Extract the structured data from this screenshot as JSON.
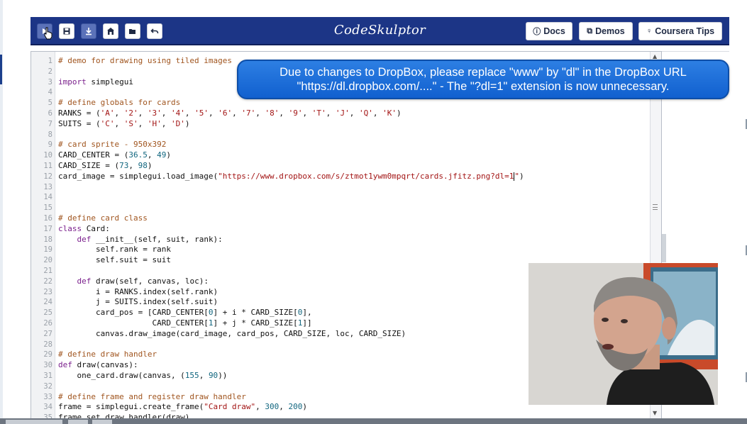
{
  "toolbar": {
    "buttons": [
      {
        "name": "run-button",
        "icon": "play-icon"
      },
      {
        "name": "save-button",
        "icon": "save-icon"
      },
      {
        "name": "download-button",
        "icon": "download-icon"
      },
      {
        "name": "reset-button",
        "icon": "home-icon"
      },
      {
        "name": "open-button",
        "icon": "folder-open-icon"
      },
      {
        "name": "undo-button",
        "icon": "undo-icon"
      }
    ],
    "brand": "CodeSkulptor",
    "docs_label": "Docs",
    "demos_label": "Demos",
    "tips_label": "Coursera Tips"
  },
  "banner": {
    "line1": "Due to changes to DropBox, please replace \"www\" by \"dl\" in the DropBox URL",
    "line2": "\"https://dl.dropbox.com/....\" - The \"?dl=1\" extension is now unnecessary."
  },
  "editor": {
    "line_numbers": [
      "1",
      "2",
      "3",
      "4",
      "5",
      "6",
      "7",
      "8",
      "9",
      "10",
      "11",
      "12",
      "13",
      "14",
      "15",
      "16",
      "17",
      "18",
      "19",
      "20",
      "21",
      "22",
      "23",
      "24",
      "25",
      "26",
      "27",
      "28",
      "29",
      "30",
      "31",
      "32",
      "33",
      "34",
      "35"
    ],
    "lines": [
      "# demo for drawing using tiled images",
      "",
      "import simplegui",
      "",
      "# define globals for cards",
      "RANKS = ('A', '2', '3', '4', '5', '6', '7', '8', '9', 'T', 'J', 'Q', 'K')",
      "SUITS = ('C', 'S', 'H', 'D')",
      "",
      "# card sprite - 950x392",
      "CARD_CENTER = (36.5, 49)",
      "CARD_SIZE = (73, 98)",
      "card_image = simplegui.load_image(\"https://www.dropbox.com/s/ztmot1ywm0mpqrt/cards.jfitz.png?dl=1\")",
      "",
      "",
      "",
      "# define card class",
      "class Card:",
      "    def __init__(self, suit, rank):",
      "        self.rank = rank",
      "        self.suit = suit",
      "",
      "    def draw(self, canvas, loc):",
      "        i = RANKS.index(self.rank)",
      "        j = SUITS.index(self.suit)",
      "        card_pos = [CARD_CENTER[0] + i * CARD_SIZE[0],",
      "                    CARD_CENTER[1] + j * CARD_SIZE[1]]",
      "        canvas.draw_image(card_image, card_pos, CARD_SIZE, loc, CARD_SIZE)",
      "",
      "# define draw handler",
      "def draw(canvas):",
      "    one_card.draw(canvas, (155, 90))",
      "",
      "# define frame and register draw handler",
      "frame = simplegui.create_frame(\"Card draw\", 300, 200)",
      "frame.set_draw_handler(draw)"
    ]
  },
  "colors": {
    "header_bg": "#1c3586",
    "banner_bg": "#1f6fd8",
    "comment": "#a0551f",
    "keyword": "#7a1f8c",
    "string": "#a31515",
    "number": "#11667f"
  }
}
